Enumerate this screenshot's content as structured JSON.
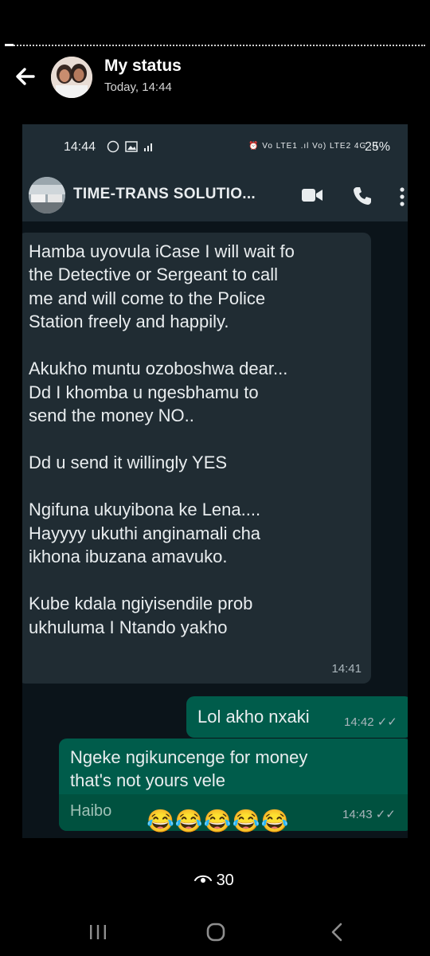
{
  "status_viewer": {
    "title": "My status",
    "time": "Today, 14:44",
    "views_count": "30",
    "progress_fraction": 0.02
  },
  "screenshot": {
    "phone_status": {
      "time": "14:44",
      "right_icons": "⏰ Vo LTE1 .ıl Vo) LTE2 4G .ıl",
      "battery": "25%"
    },
    "chat": {
      "name": "TIME-TRANS SOLUTIO...",
      "messages": [
        {
          "direction": "incoming",
          "text": "Hamba uyovula iCase I will wait fo\nthe Detective or Sergeant to call\nme and will come to the Police\nStation freely and happily.\n\nAkukho muntu ozoboshwa dear...\nDd I khomba u ngesbhamu to\nsend the money NO..\n\nDd u send it willingly YES\n\nNgifuna ukuyibona ke Lena....\nHayyyy ukuthi anginamali cha\nikhona ibuzana amavuko.\n\nKube kdala ngiyisendile prob\nukhuluma I Ntando yakho",
          "time": "14:41"
        },
        {
          "direction": "outgoing",
          "text": "Lol akho nxaki",
          "time": "14:42 ✓✓"
        },
        {
          "direction": "outgoing",
          "text": "Ngeke ngikuncenge for money\nthat's not yours vele",
          "quote": "Haibo",
          "time": "14:43 ✓✓",
          "emojis": "😂😂😂😂😂"
        }
      ]
    }
  },
  "icons": {
    "back": "arrow-left-icon",
    "video": "video-camera-icon",
    "call": "phone-icon",
    "menu": "more-vert-icon",
    "views": "eye-icon"
  },
  "colors": {
    "incoming_bubble": "#202c33",
    "outgoing_bubble": "#005c4b",
    "chat_background": "#0b141a",
    "header": "#1f2c34"
  }
}
